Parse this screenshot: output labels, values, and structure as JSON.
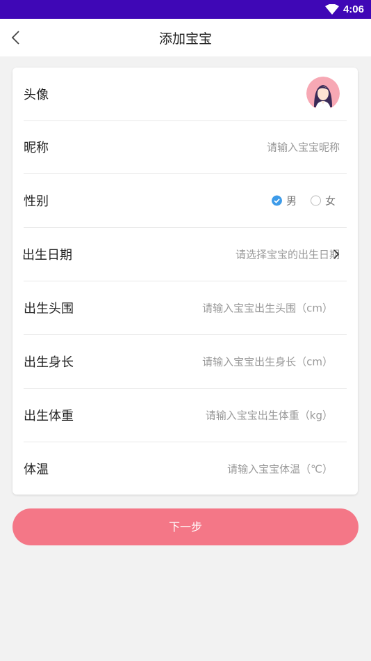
{
  "status_bar": {
    "time": "4:06"
  },
  "header": {
    "title": "添加宝宝"
  },
  "form": {
    "avatar_label": "头像",
    "nickname_label": "昵称",
    "nickname_placeholder": "请输入宝宝昵称",
    "gender_label": "性别",
    "gender_male": "男",
    "gender_female": "女",
    "gender_selected": "男",
    "birthdate_label": "出生日期",
    "birthdate_placeholder": "请选择宝宝的出生日期",
    "head_label": "出生头围",
    "head_placeholder": "请输入宝宝出生头围（cm）",
    "length_label": "出生身长",
    "length_placeholder": "请输入宝宝出生身长（cm）",
    "weight_label": "出生体重",
    "weight_placeholder": "请输入宝宝出生体重（kg）",
    "temp_label": "体温",
    "temp_placeholder": "请输入宝宝体温（℃）"
  },
  "next_button": "下一步",
  "colors": {
    "status_bar": "#3f07b6",
    "accent": "#f47787",
    "radio_checked": "#3d9be9"
  },
  "icons": [
    "wifi-icon",
    "back-arrow-icon",
    "avatar-image",
    "checked-radio-icon",
    "unchecked-radio-icon",
    "chevron-right-icon"
  ]
}
